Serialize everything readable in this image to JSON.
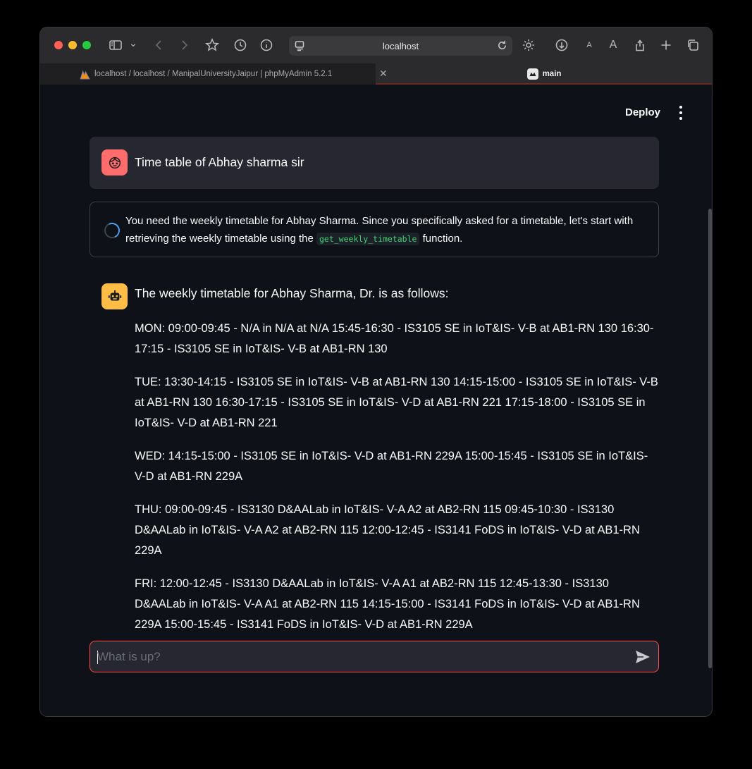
{
  "browser": {
    "url": "localhost",
    "tabs": [
      {
        "label": "localhost / localhost / ManipalUniversityJaipur | phpMyAdmin 5.2.1"
      },
      {
        "label": "main"
      }
    ]
  },
  "app": {
    "deploy_label": "Deploy",
    "user_message": "Time table of Abhay sharma sir",
    "status": {
      "text_before": "You need the weekly timetable for Abhay Sharma. Since you specifically asked for a timetable, let's start with retrieving the weekly timetable using the",
      "code": "get_weekly_timetable",
      "text_after": "function."
    },
    "assistant": {
      "intro": "The weekly timetable for Abhay Sharma, Dr. is as follows:",
      "days": [
        "MON: 09:00-09:45 - N/A in N/A at N/A 15:45-16:30 - IS3105 SE in IoT&IS- V-B at AB1-RN 130 16:30-17:15 - IS3105 SE in IoT&IS- V-B at AB1-RN 130",
        "TUE: 13:30-14:15 - IS3105 SE in IoT&IS- V-B at AB1-RN 130 14:15-15:00 - IS3105 SE in IoT&IS- V-B at AB1-RN 130 16:30-17:15 - IS3105 SE in IoT&IS- V-D at AB1-RN 221 17:15-18:00 - IS3105 SE in IoT&IS- V-D at AB1-RN 221",
        "WED: 14:15-15:00 - IS3105 SE in IoT&IS- V-D at AB1-RN 229A 15:00-15:45 - IS3105 SE in IoT&IS- V-D at AB1-RN 229A",
        "THU: 09:00-09:45 - IS3130 D&AALab in IoT&IS- V-A A2 at AB2-RN 115 09:45-10:30 - IS3130 D&AALab in IoT&IS- V-A A2 at AB2-RN 115 12:00-12:45 - IS3141 FoDS in IoT&IS- V-D at AB1-RN 229A",
        "FRI: 12:00-12:45 - IS3130 D&AALab in IoT&IS- V-A A1 at AB2-RN 115 12:45-13:30 - IS3130 D&AALab in IoT&IS- V-A A1 at AB2-RN 115 14:15-15:00 - IS3141 FoDS in IoT&IS- V-D at AB1-RN 229A 15:00-15:45 - IS3141 FoDS in IoT&IS- V-D at AB1-RN 229A"
      ]
    },
    "chat_input": {
      "value": "",
      "placeholder": "What is up?"
    }
  },
  "colors": {
    "background": "#0e1117",
    "accent_red": "#ff4b4b",
    "user_avatar": "#ff6c6c",
    "bot_avatar": "#ffbd45",
    "code_green": "#3dd56d"
  },
  "icons": [
    "sidebar-icon",
    "chevron-down-icon",
    "back-icon",
    "forward-icon",
    "star-icon",
    "history-icon",
    "info-icon",
    "reader-icon",
    "reload-icon",
    "gear-icon",
    "download-icon",
    "text-smaller-icon",
    "text-larger-icon",
    "share-icon",
    "plus-icon",
    "tabs-overview-icon",
    "close-icon",
    "user-face-icon",
    "robot-icon",
    "send-icon",
    "kebab-menu-icon"
  ]
}
